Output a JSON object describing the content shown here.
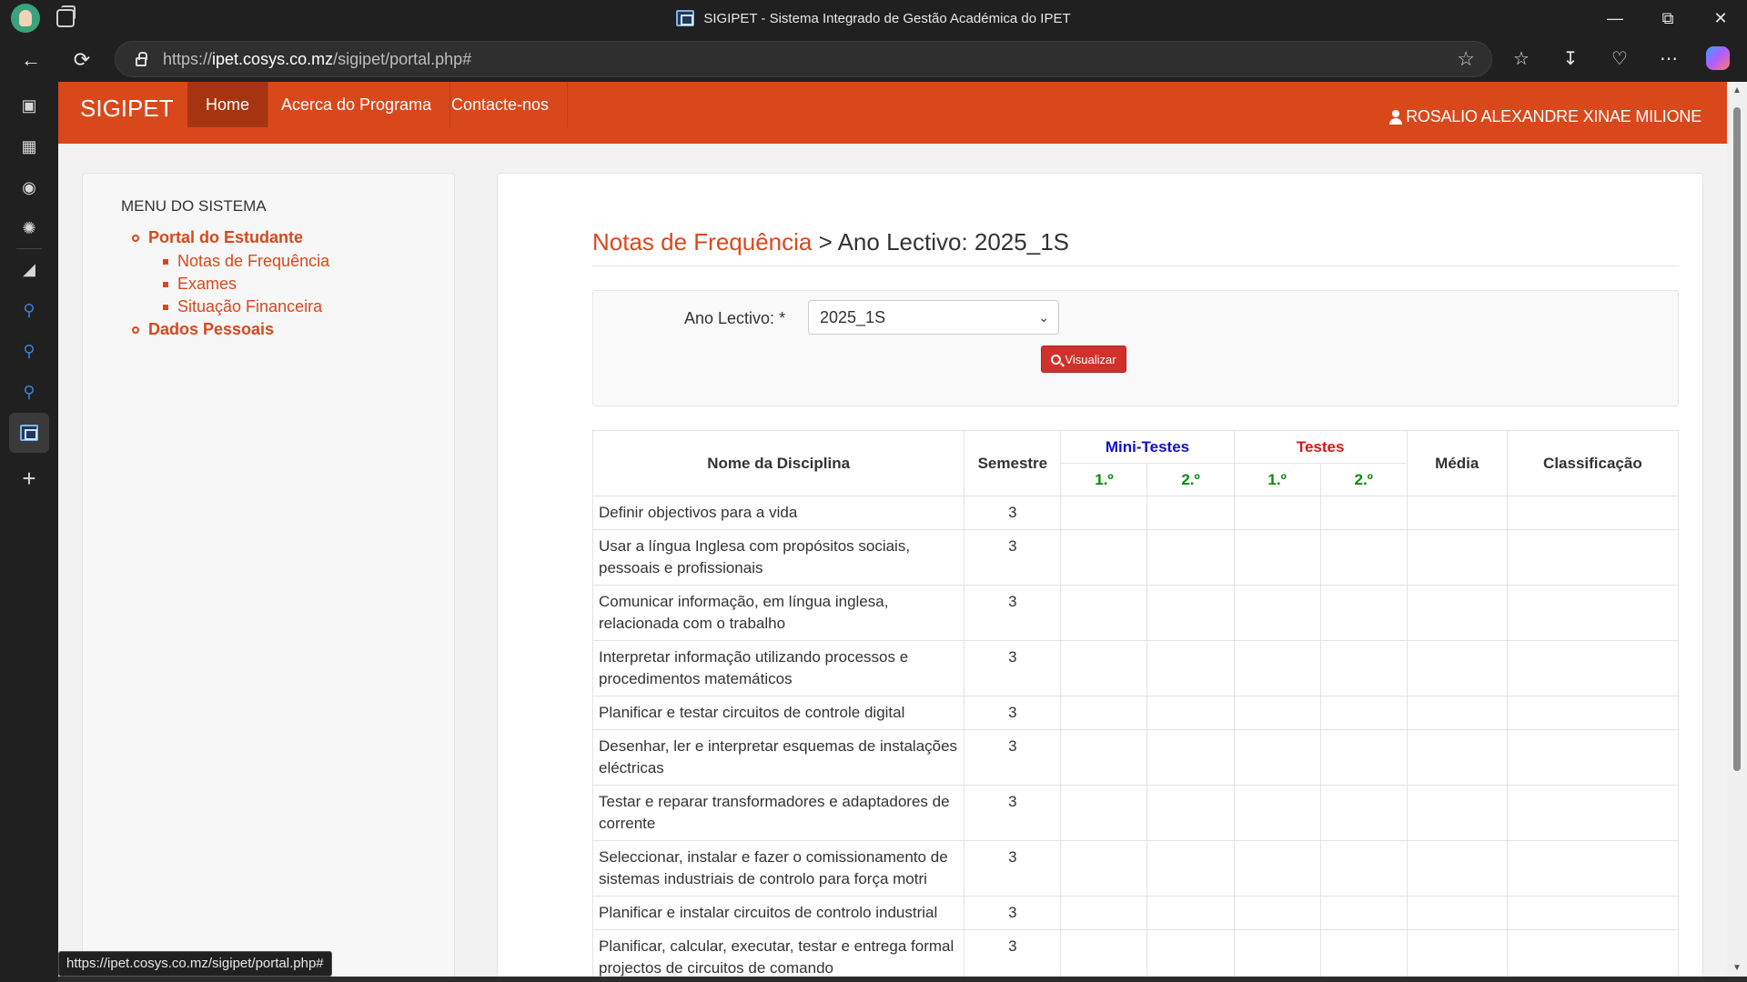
{
  "browser": {
    "window_title": "SIGIPET - Sistema Integrado de Gestão Académica do IPET",
    "url_prefix": "https://",
    "url_host": "ipet.cosys.co.mz",
    "url_path": "/sigipet/portal.php#",
    "status_link": "https://ipet.cosys.co.mz/sigipet/portal.php#"
  },
  "app": {
    "brand": "SIGIPET",
    "menu": [
      "Home",
      "Acerca do Programa",
      "Contacte-nos"
    ],
    "user_name": "ROSALIO ALEXANDRE XINAE MILIONE"
  },
  "side_menu": {
    "title": "MENU DO SISTEMA",
    "portal": "Portal do Estudante",
    "items": [
      "Notas de Frequência",
      "Exames",
      "Situação Financeira"
    ],
    "personal": "Dados Pessoais"
  },
  "main": {
    "crumb": "Notas de Frequência",
    "separator": " > ",
    "heading": "Ano Lectivo: 2025_1S",
    "filter_label": "Ano Lectivo: *",
    "select_value": "2025_1S",
    "button_label": "Visualizar"
  },
  "table": {
    "headers": {
      "discipline": "Nome da Disciplina",
      "semester": "Semestre",
      "mini_tests": "Mini-Testes",
      "tests": "Testes",
      "average": "Média",
      "classification": "Classificação",
      "first": "1.º",
      "second": "2.º"
    },
    "rows": [
      {
        "name": "Definir objectivos para a vida",
        "semester": "3"
      },
      {
        "name": "Usar a língua Inglesa com propósitos sociais, pessoais e profissionais",
        "semester": "3"
      },
      {
        "name": "Comunicar informação, em língua inglesa, relacionada com o trabalho",
        "semester": "3"
      },
      {
        "name": "Interpretar informação utilizando processos e procedimentos matemáticos",
        "semester": "3"
      },
      {
        "name": "Planificar e testar circuitos de controle digital",
        "semester": "3"
      },
      {
        "name": "Desenhar, ler e interpretar esquemas de instalações eléctricas",
        "semester": "3"
      },
      {
        "name": "Testar e reparar transformadores e adaptadores de corrente",
        "semester": "3"
      },
      {
        "name": "Seleccionar, instalar e fazer o comissionamento de sistemas industriais de controlo para força motri",
        "semester": "3"
      },
      {
        "name": "Planificar e instalar circuitos de controlo industrial",
        "semester": "3"
      },
      {
        "name": "Planificar, calcular, executar, testar e entrega formal projectos de circuitos de comando",
        "semester": "3"
      }
    ]
  },
  "colors": {
    "brand_orange": "#d9481b",
    "mini_tests_blue": "#1010cc",
    "tests_red": "#d41818",
    "sub_header_green": "#0a8a0a",
    "button_red": "#d2312b"
  }
}
